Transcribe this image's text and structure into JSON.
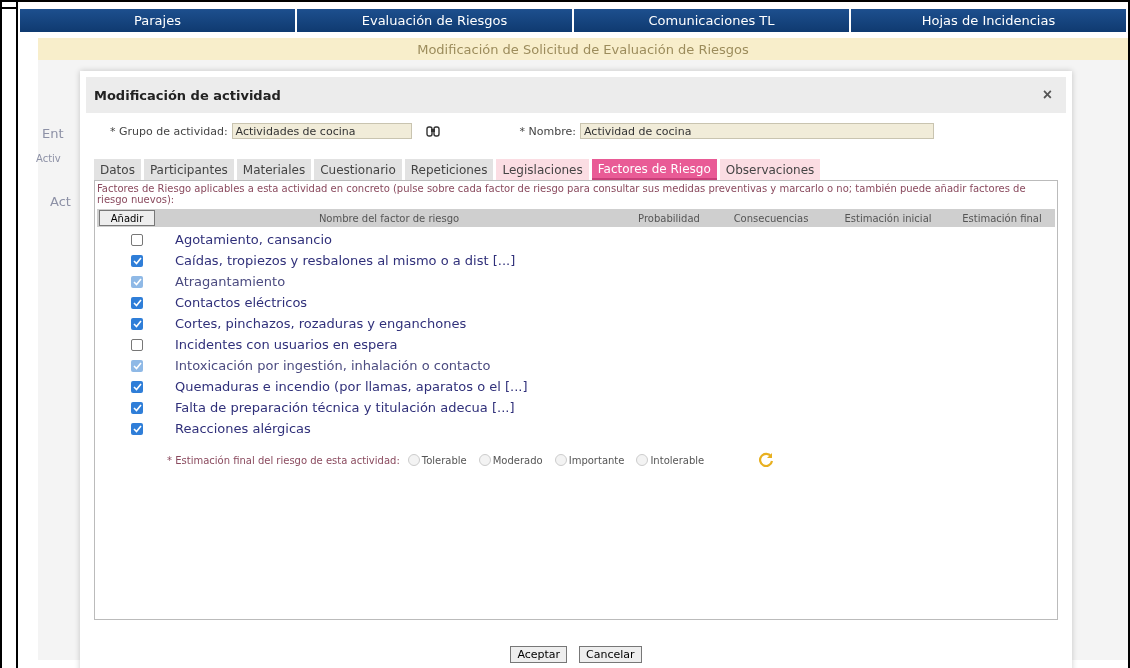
{
  "nav": [
    {
      "label": "Parajes"
    },
    {
      "label": "Evaluación de Riesgos"
    },
    {
      "label": "Comunicaciones TL"
    },
    {
      "label": "Hojas de Incidencias"
    }
  ],
  "page_title": "Modificación de Solicitud de Evaluación de Riesgos",
  "background_fragments": {
    "tab": "Ent",
    "header": "Activ",
    "cell": "Act"
  },
  "dialog": {
    "title": "Modificación de actividad",
    "close": "×",
    "fields": [
      {
        "label": "* Grupo de actividad:",
        "value": "Actividades de cocina"
      },
      {
        "label": "* Nombre:",
        "value": "Actividad de cocina"
      }
    ],
    "tabs": [
      {
        "label": "Datos",
        "selected": false,
        "kind": "plain"
      },
      {
        "label": "Participantes",
        "selected": false,
        "kind": "plain"
      },
      {
        "label": "Materiales",
        "selected": false,
        "kind": "plain"
      },
      {
        "label": "Cuestionario",
        "selected": false,
        "kind": "plain"
      },
      {
        "label": "Repeticiones",
        "selected": false,
        "kind": "plain"
      },
      {
        "label": "Legislaciones",
        "selected": false,
        "kind": "pink"
      },
      {
        "label": "Factores de Riesgo",
        "selected": true,
        "kind": "pink"
      },
      {
        "label": "Observaciones",
        "selected": false,
        "kind": "pink"
      }
    ],
    "intro": "Factores de Riesgo aplicables a esta actividad en concreto (pulse sobre cada factor de riesgo para consultar sus medidas preventivas y marcarlo o no; también puede añadir factores de riesgo nuevos):",
    "add_button": "Añadir",
    "columns": [
      "Nombre del factor de riesgo",
      "Probabilidad",
      "Consecuencias",
      "Estimación inicial",
      "Estimación final"
    ],
    "factors": [
      {
        "name": "Agotamiento, cansancio",
        "checked": false,
        "disabled": false
      },
      {
        "name": "Caídas, tropiezos y resbalones al mismo o a dist [...]",
        "checked": true,
        "disabled": false
      },
      {
        "name": "Atragantamiento",
        "checked": true,
        "disabled": true
      },
      {
        "name": "Contactos eléctricos",
        "checked": true,
        "disabled": false
      },
      {
        "name": "Cortes, pinchazos, rozaduras y enganchones",
        "checked": true,
        "disabled": false
      },
      {
        "name": "Incidentes con usuarios en espera",
        "checked": false,
        "disabled": false
      },
      {
        "name": "Intoxicación por ingestión, inhalación o contacto",
        "checked": true,
        "disabled": true
      },
      {
        "name": "Quemaduras e incendio (por llamas, aparatos o el [...]",
        "checked": true,
        "disabled": false
      },
      {
        "name": "Falta de preparación técnica y titulación adecua [...]",
        "checked": true,
        "disabled": false
      },
      {
        "name": "Reacciones alérgicas",
        "checked": true,
        "disabled": false
      }
    ],
    "estimate": {
      "label": "* Estimación final del riesgo de esta actividad:",
      "options": [
        {
          "label": "Tolerable",
          "selected": false
        },
        {
          "label": "Moderado",
          "selected": false
        },
        {
          "label": "Importante",
          "selected": false
        },
        {
          "label": "Intolerable",
          "selected": false
        }
      ]
    },
    "buttons": [
      "Aceptar",
      "Cancelar"
    ]
  }
}
